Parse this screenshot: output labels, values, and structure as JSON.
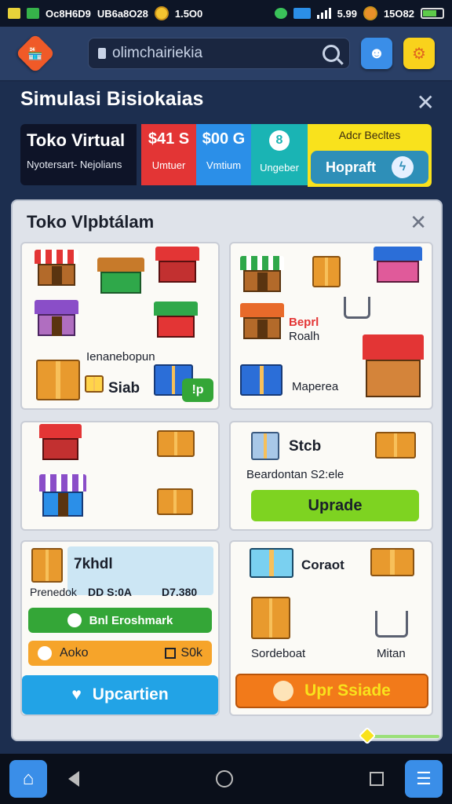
{
  "status_bar": {
    "left_text": "Oc8H6D9",
    "mid_text": "UB6a8O28",
    "coin_value": "1.5O0",
    "signal_value": "5.99",
    "right_coin_value": "15O82"
  },
  "app_bar": {
    "url_text": "olimchairiekia",
    "logo_icon": "store-icon",
    "blue_btn_icon": "face-icon",
    "yellow_btn_icon": "gear-icon"
  },
  "header": {
    "title": "Simulasi Bisiokaias"
  },
  "stats": {
    "store_name": "Toko Virtual",
    "store_sub": "Nyotersart- Nejolians",
    "stat1_value": "$41 S",
    "stat1_label": "Umtuer",
    "stat2_value": "$00 G",
    "stat2_label": "Vmtium",
    "stat3_value": "8",
    "stat3_label": "Ungeber",
    "right_caption": "Adcr Becltes",
    "upgrade_label": "Hopraft"
  },
  "panel": {
    "title": "Toko Vlpbtálam",
    "card1": {
      "label": "Ienanebopun",
      "tag": "Siab",
      "badge": "!p"
    },
    "card2": {
      "label_red": "Beprl",
      "label_sub": "Roalh",
      "label": "Maperea"
    },
    "card3": {},
    "card4": {
      "title": "Stcb",
      "desc": "Beardontan S2:ele",
      "button": "Uprade"
    },
    "card5": {
      "title": "7khdl",
      "price_label": "Prenedok",
      "price1": "DD S:0A",
      "price2": "D7.380",
      "green_btn": "Bnl Eroshmark",
      "orange_left": "Aoko",
      "orange_right": "S0k",
      "big_btn": "Upcartien"
    },
    "card6": {
      "title": "Coraot",
      "left_label": "Sordeboat",
      "right_label": "Mitan",
      "big_btn": "Upr Ssiade"
    }
  },
  "colors": {
    "accent_orange": "#f05a28",
    "accent_yellow": "#f9e21c",
    "stat_red": "#e33535",
    "stat_blue": "#2b8fe8",
    "stat_teal": "#1ab4b4",
    "btn_green": "#34a637",
    "btn_blue": "#22a3e6",
    "btn_orange": "#f27a1a"
  }
}
